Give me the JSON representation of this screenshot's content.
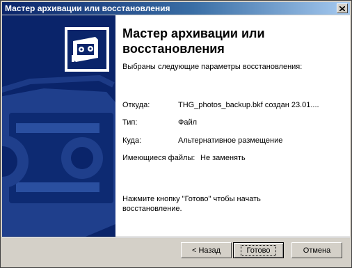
{
  "window": {
    "title": "Мастер архивации или восстановления",
    "close_glyph": "✕"
  },
  "main": {
    "heading": "Мастер архивации или восстановления",
    "subtext": "Выбраны следующие параметры восстановления:",
    "rows": [
      {
        "label": "Откуда:",
        "value": "THG_photos_backup.bkf создан 23.01...."
      },
      {
        "label": "Тип:",
        "value": "Файл"
      },
      {
        "label": "Куда:",
        "value": "Альтернативное размещение"
      },
      {
        "label": "Имеющиеся файлы:",
        "value": "Не заменять"
      }
    ],
    "final_text": "Нажмите кнопку \"Готово\" чтобы начать восстановление."
  },
  "buttons": {
    "back": "< Назад",
    "finish": "Готово",
    "cancel": "Отмена"
  },
  "icons": {
    "wizard_icon": "backup-tape-icon",
    "side_art": "tape-cassette-art"
  },
  "colors": {
    "title_bar_start": "#0a246a",
    "title_bar_end": "#a6caf0",
    "side_panel": "#0a246a",
    "dialog_face": "#d4d0c8"
  }
}
